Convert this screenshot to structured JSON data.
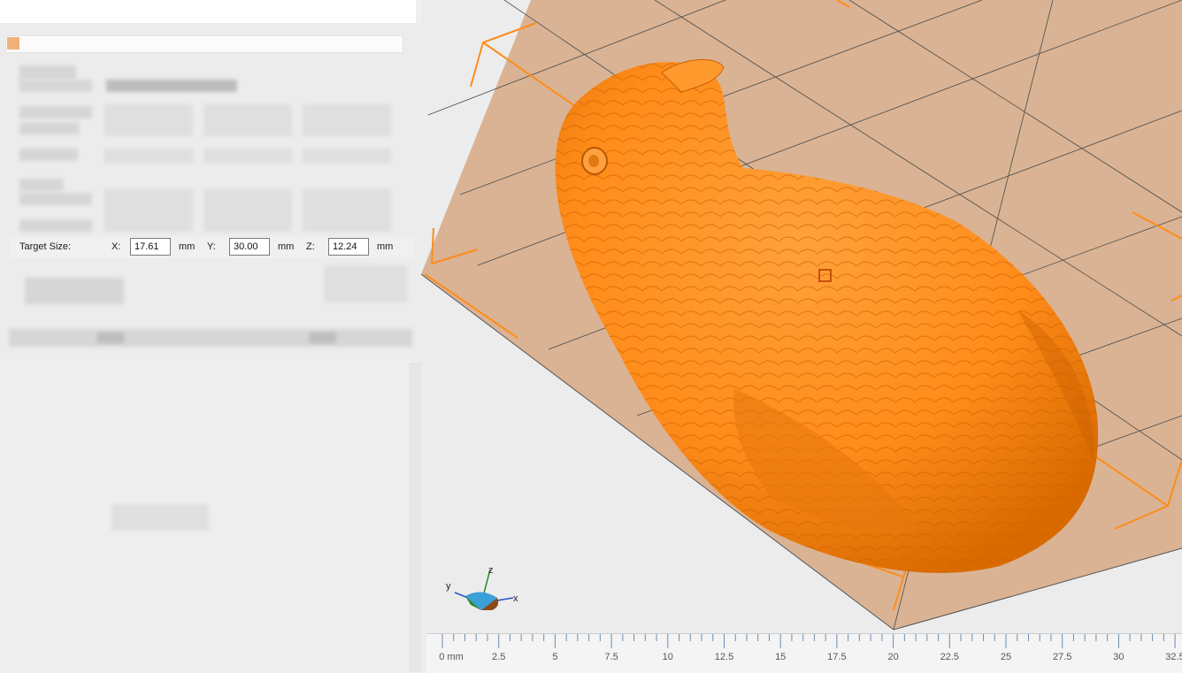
{
  "dialog": {
    "target_size_label": "Target Size:",
    "x_label": "X:",
    "x_value": "17.61",
    "y_label": "Y:",
    "y_value": "30.00",
    "z_label": "Z:",
    "z_value": "12.24",
    "unit": "mm"
  },
  "viewport": {
    "model": "bird-figurine",
    "model_color": "#ff8c1a",
    "bed_color": "#d9b394",
    "axes": {
      "x": "x",
      "y": "y",
      "z": "z"
    }
  },
  "ruler": {
    "labels": [
      "0 mm",
      "2.5",
      "5",
      "7.5",
      "10",
      "12.5",
      "15",
      "17.5",
      "20",
      "22.5",
      "25",
      "27.5",
      "30",
      "32.5"
    ]
  }
}
